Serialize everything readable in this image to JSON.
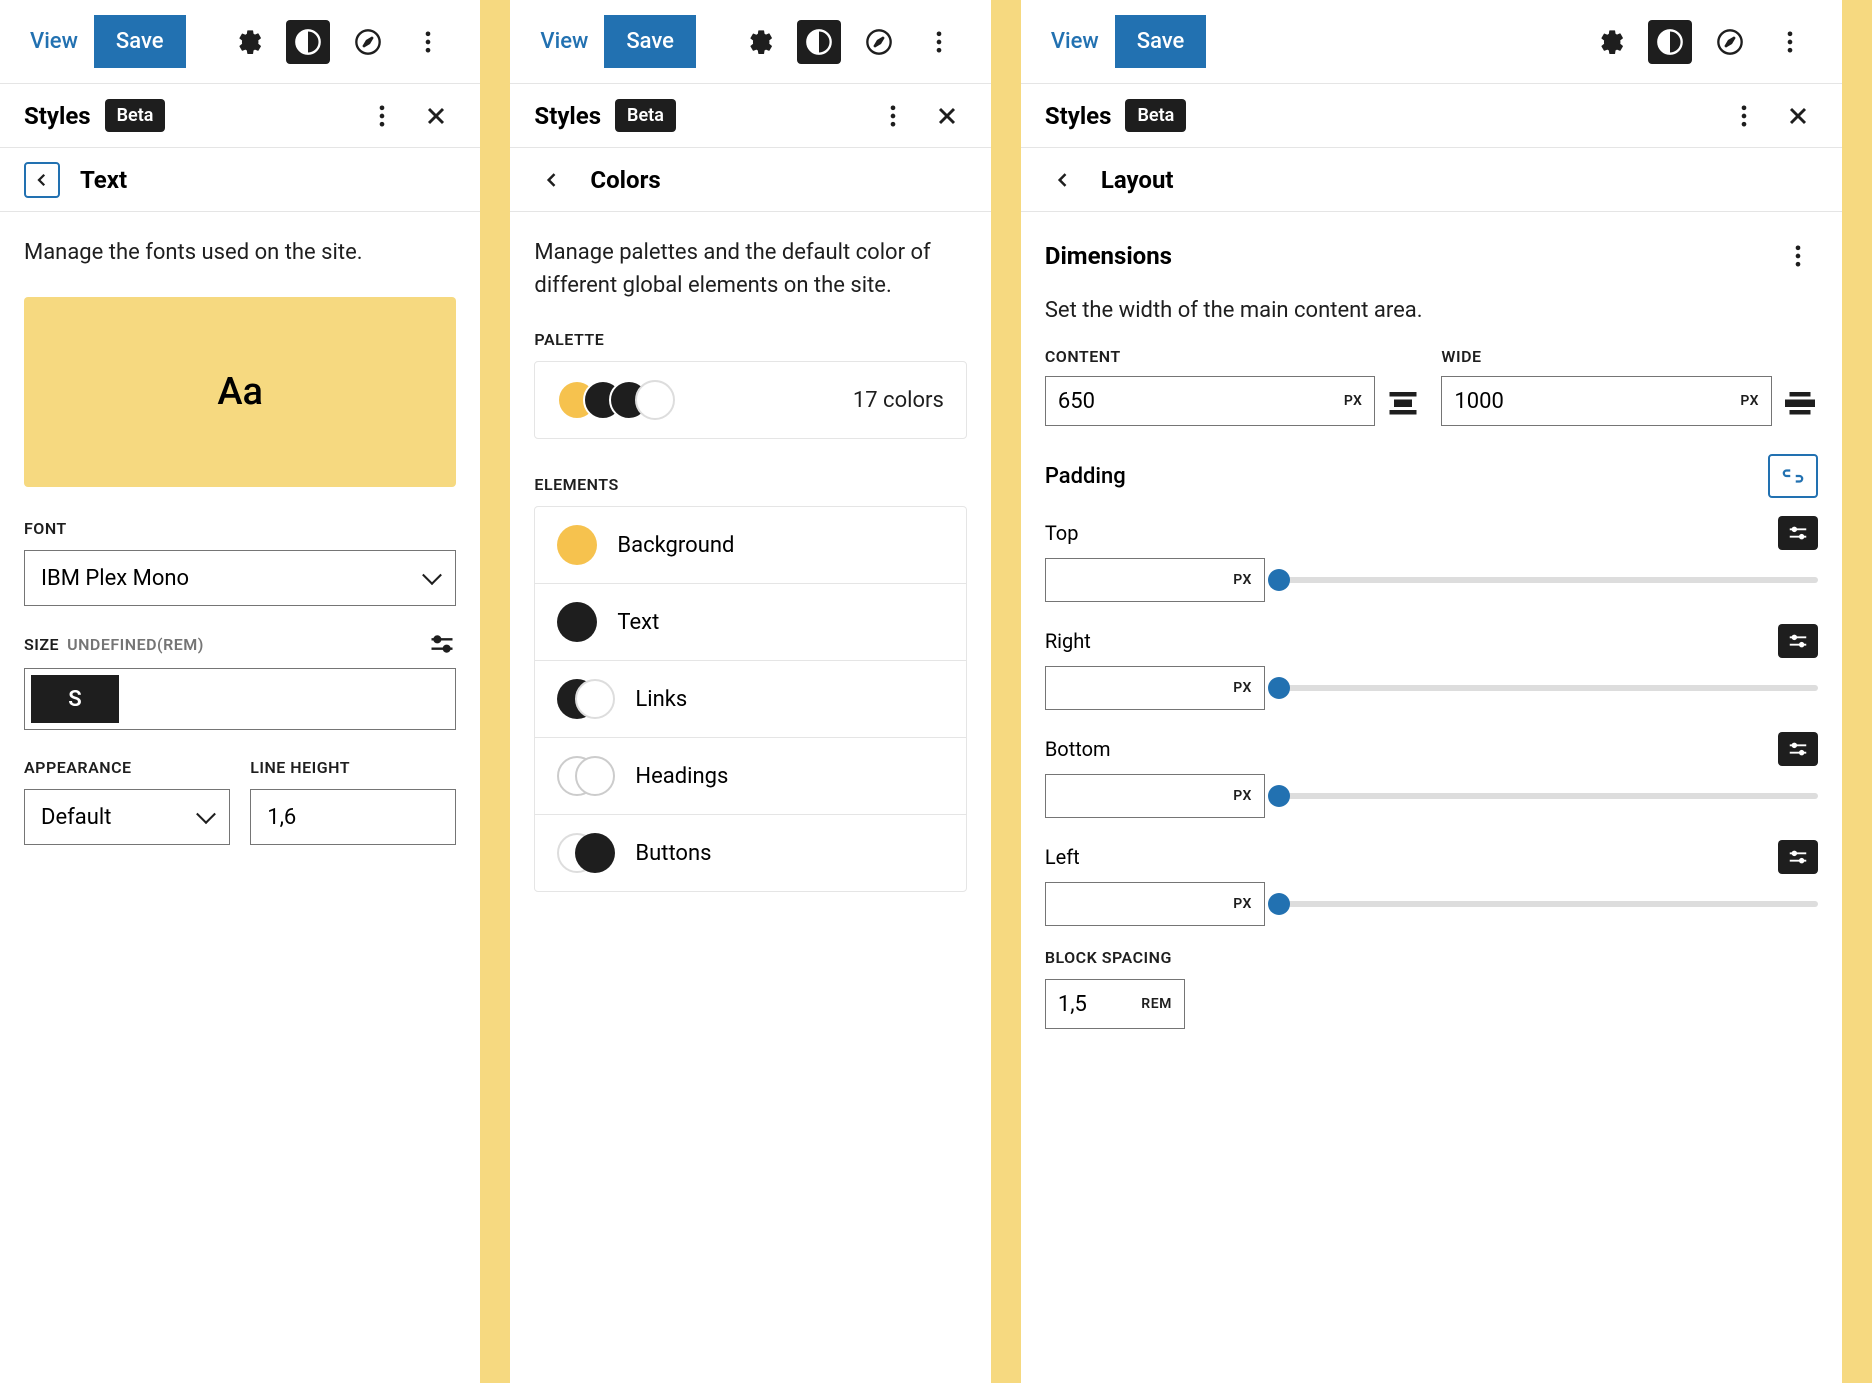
{
  "toolbar": {
    "view": "View",
    "save": "Save"
  },
  "panel": {
    "title": "Styles",
    "beta": "Beta"
  },
  "text_panel": {
    "nav_title": "Text",
    "desc": "Manage the fonts used on the site.",
    "preview": "Aa",
    "font_label": "FONT",
    "font_value": "IBM Plex Mono",
    "size_label": "SIZE",
    "size_unit": "UNDEFINED(REM)",
    "size_value": "S",
    "appearance_label": "APPEARANCE",
    "appearance_value": "Default",
    "line_height_label": "LINE HEIGHT",
    "line_height_value": "1,6"
  },
  "colors_panel": {
    "nav_title": "Colors",
    "desc": "Manage palettes and the default color of different global elements on the site.",
    "palette_label": "PALETTE",
    "palette_count": "17 colors",
    "palette_swatches": [
      "#f6c24e",
      "#1e1e1e",
      "#1e1e1e",
      "#fff"
    ],
    "elements_label": "ELEMENTS",
    "elements": [
      {
        "name": "Background",
        "color": "#f6c24e",
        "dual": false
      },
      {
        "name": "Text",
        "color": "#1e1e1e",
        "dual": false
      },
      {
        "name": "Links",
        "color": "#1e1e1e",
        "dual": true
      },
      {
        "name": "Headings",
        "color": "#fff",
        "dual": true,
        "outline": true
      },
      {
        "name": "Buttons",
        "color": "#1e1e1e",
        "dual": true
      }
    ]
  },
  "layout_panel": {
    "nav_title": "Layout",
    "dimensions_title": "Dimensions",
    "dimensions_desc": "Set the width of the main content area.",
    "content_label": "CONTENT",
    "content_value": "650",
    "content_unit": "PX",
    "wide_label": "WIDE",
    "wide_value": "1000",
    "wide_unit": "PX",
    "padding_title": "Padding",
    "pad_sides": [
      "Top",
      "Right",
      "Bottom",
      "Left"
    ],
    "pad_unit": "PX",
    "block_spacing_label": "BLOCK SPACING",
    "block_spacing_value": "1,5",
    "block_spacing_unit": "REM"
  }
}
